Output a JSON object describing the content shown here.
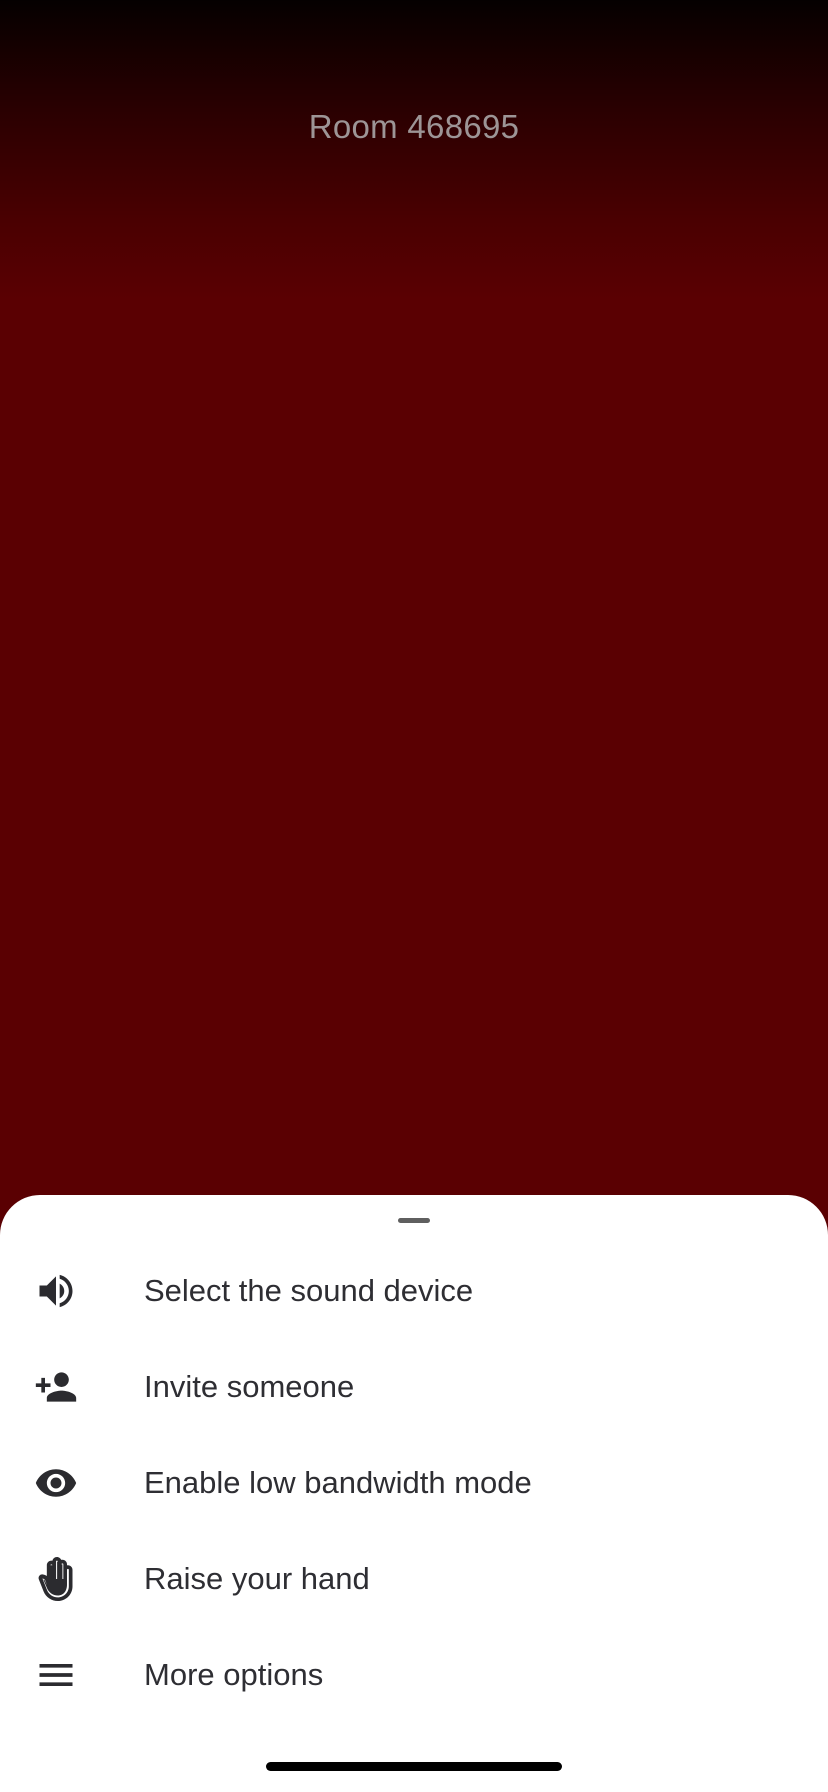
{
  "room": {
    "title": "Room 468695"
  },
  "colors": {
    "background_red": "#5a0002",
    "sheet_background": "#ffffff",
    "icon_color": "#2b2b2f"
  },
  "menu": {
    "items": [
      {
        "label": "Select the sound device",
        "icon": "speaker-icon"
      },
      {
        "label": "Invite someone",
        "icon": "person-add-icon"
      },
      {
        "label": "Enable low bandwidth mode",
        "icon": "eye-icon"
      },
      {
        "label": "Raise your hand",
        "icon": "hand-icon"
      },
      {
        "label": "More options",
        "icon": "menu-icon"
      }
    ]
  }
}
